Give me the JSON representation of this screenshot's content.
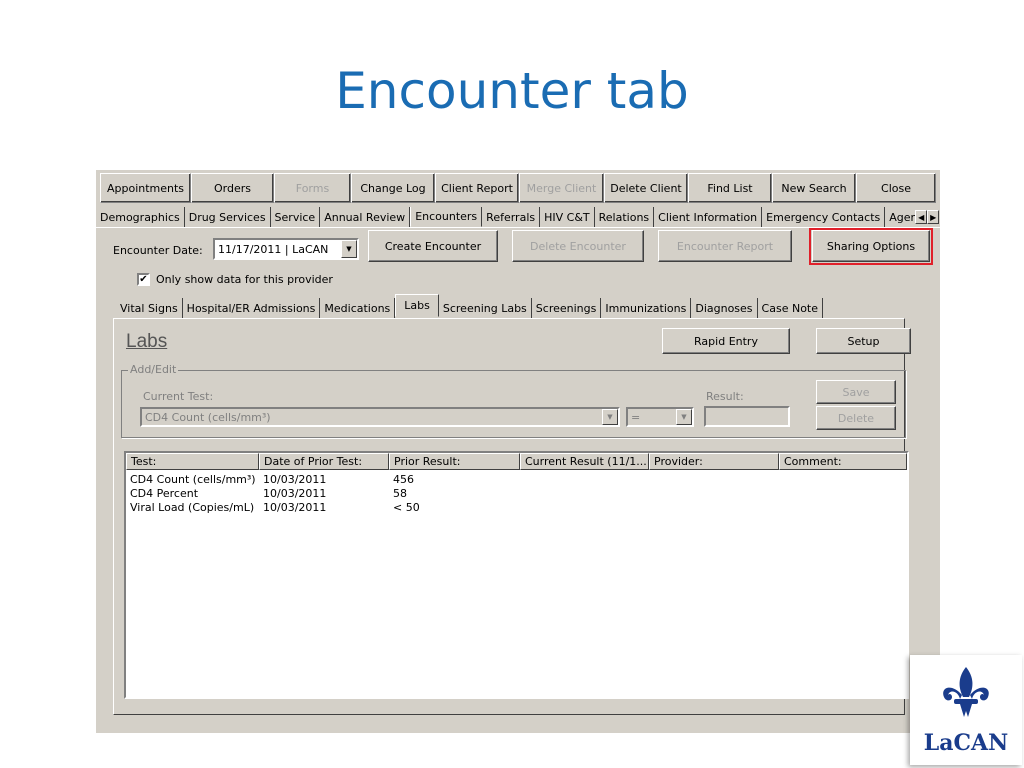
{
  "slide": {
    "title": "Encounter tab",
    "logo_text": "LaCAN"
  },
  "toolbar": {
    "buttons": [
      {
        "label": "Appointments",
        "enabled": true
      },
      {
        "label": "Orders",
        "enabled": true
      },
      {
        "label": "Forms",
        "enabled": false
      },
      {
        "label": "Change Log",
        "enabled": true
      },
      {
        "label": "Client Report",
        "enabled": true
      },
      {
        "label": "Merge Client",
        "enabled": false
      },
      {
        "label": "Delete Client",
        "enabled": true
      },
      {
        "label": "Find List",
        "enabled": true
      },
      {
        "label": "New Search",
        "enabled": true
      },
      {
        "label": "Close",
        "enabled": true
      }
    ]
  },
  "main_tabs": [
    "Demographics",
    "Drug Services",
    "Service",
    "Annual Review",
    "Encounters",
    "Referrals",
    "HIV C&T",
    "Relations",
    "Client Information",
    "Emergency Contacts",
    "Agen"
  ],
  "main_tabs_active": "Encounters",
  "encounter": {
    "date_label": "Encounter Date:",
    "date_value": "11/17/2011  |  LaCAN",
    "create_button": "Create Encounter",
    "delete_button": "Delete Encounter",
    "report_button": "Encounter Report",
    "sharing_button": "Sharing Options",
    "only_show_label": "Only show data for this provider",
    "only_show_checked": "✔"
  },
  "sub_tabs": [
    "Vital Signs",
    "Hospital/ER Admissions",
    "Medications",
    "Labs",
    "Screening Labs",
    "Screenings",
    "Immunizations",
    "Diagnoses",
    "Case Note"
  ],
  "sub_tabs_active": "Labs",
  "labs": {
    "heading": "Labs",
    "rapid_entry": "Rapid Entry",
    "setup": "Setup",
    "add_edit_legend": "Add/Edit",
    "current_test_label": "Current Test:",
    "current_test_value": "CD4 Count (cells/mm³)",
    "operator_value": "=",
    "result_label": "Result:",
    "save_button": "Save",
    "delete_button": "Delete",
    "columns": [
      "Test:",
      "Date of Prior Test:",
      "Prior Result:",
      "Current Result (11/1...",
      "Provider:",
      "Comment:"
    ],
    "rows": [
      [
        "CD4 Count (cells/mm³)",
        "10/03/2011",
        "456",
        "",
        "",
        ""
      ],
      [
        "CD4 Percent",
        "10/03/2011",
        "58",
        "",
        "",
        ""
      ],
      [
        "Viral Load (Copies/mL)",
        "10/03/2011",
        "< 50",
        "",
        "",
        ""
      ]
    ]
  },
  "icons": {
    "dropdown": "▼",
    "scroll_left": "◀",
    "scroll_right": "▶"
  }
}
